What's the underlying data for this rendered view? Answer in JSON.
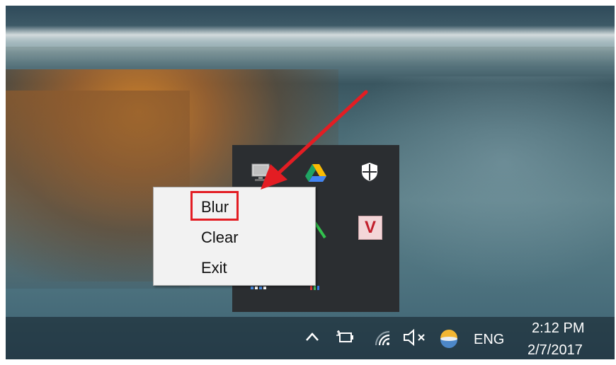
{
  "context_menu": {
    "items": [
      {
        "label": "Blur"
      },
      {
        "label": "Clear"
      },
      {
        "label": "Exit"
      }
    ],
    "highlighted": "Blur"
  },
  "tray_flyout": {
    "icons": [
      "monitor-icon",
      "google-drive-icon",
      "shield-icon",
      "green-app-icon",
      "v-app-icon",
      "dots-icon",
      "bars-icon"
    ],
    "v_label": "V"
  },
  "taskbar": {
    "chevron": "^",
    "language": "ENG",
    "time": "2:12 PM",
    "date": "2/7/2017",
    "icons": [
      "show-hidden-icons-chevron",
      "power-icon",
      "wifi-icon",
      "volume-muted-icon",
      "weather-icon"
    ]
  },
  "colors": {
    "highlight": "#e31d23",
    "flyout_bg": "#2b2e31",
    "menu_bg": "#f2f2f2"
  }
}
